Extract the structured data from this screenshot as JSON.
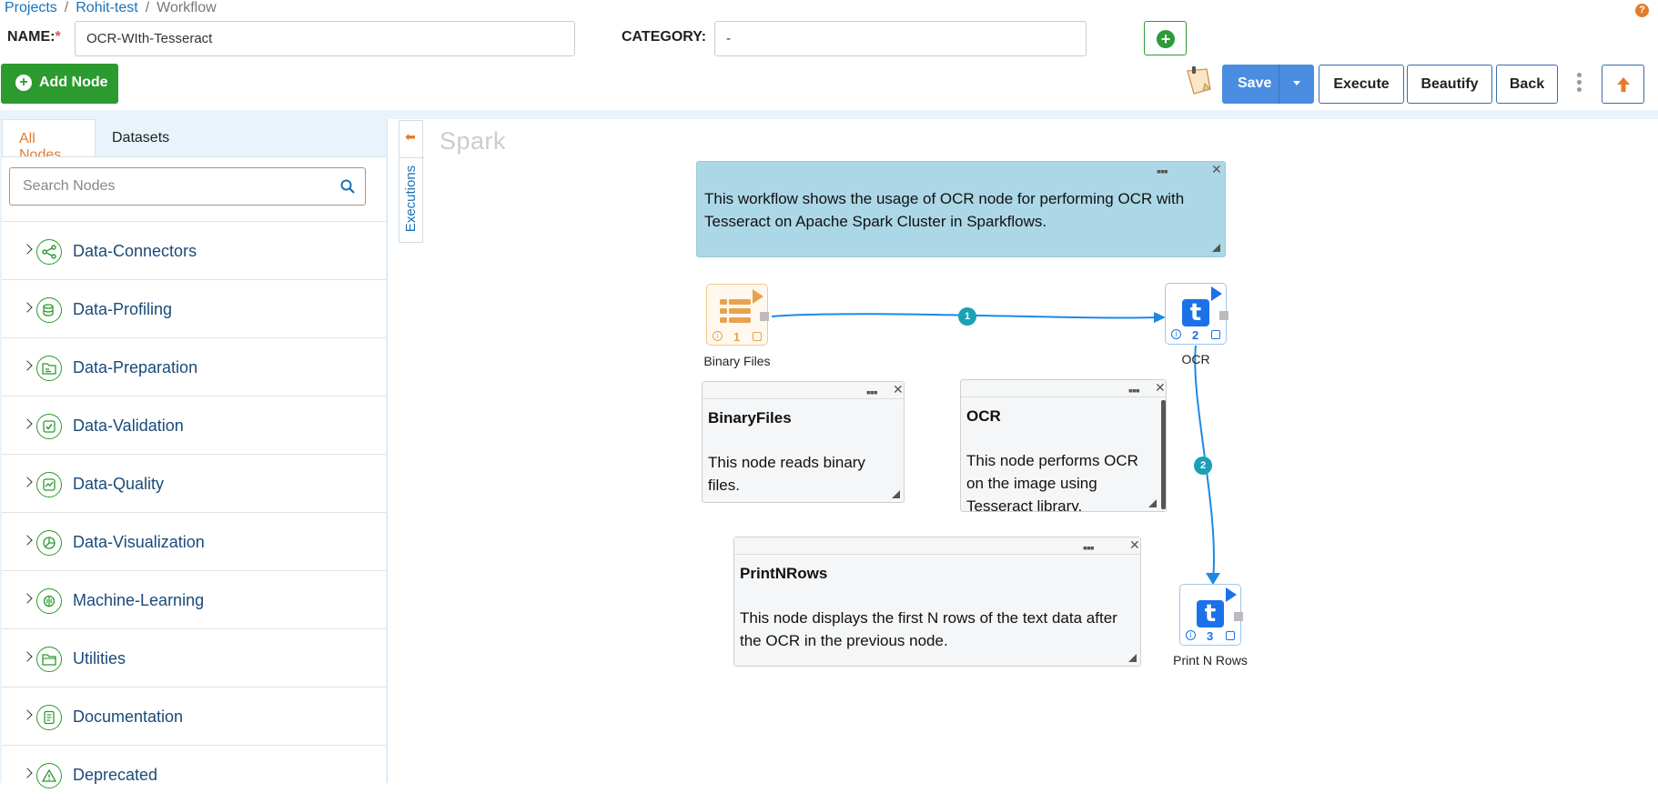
{
  "breadcrumb": {
    "items": [
      "Projects",
      "Rohit-test",
      "Workflow"
    ],
    "separator": "/"
  },
  "form": {
    "name_label": "NAME:",
    "name_required": "*",
    "name_value": "OCR-WIth-Tesseract",
    "category_label": "CATEGORY:",
    "category_value": "-"
  },
  "toolbar": {
    "add_node_label": "Add Node",
    "save_label": "Save",
    "execute_label": "Execute",
    "beautify_label": "Beautify",
    "back_label": "Back"
  },
  "sidebar": {
    "tabs": [
      {
        "label": "All Nodes",
        "active": true
      },
      {
        "label": "Datasets",
        "active": false
      }
    ],
    "search_placeholder": "Search Nodes",
    "categories": [
      {
        "label": "Data-Connectors",
        "icon": "share-icon"
      },
      {
        "label": "Data-Profiling",
        "icon": "database-icon"
      },
      {
        "label": "Data-Preparation",
        "icon": "folder-icon"
      },
      {
        "label": "Data-Validation",
        "icon": "checkbox-icon"
      },
      {
        "label": "Data-Quality",
        "icon": "chart-box-icon"
      },
      {
        "label": "Data-Visualization",
        "icon": "pie-chart-icon"
      },
      {
        "label": "Machine-Learning",
        "icon": "brain-icon"
      },
      {
        "label": "Utilities",
        "icon": "folder-icon"
      },
      {
        "label": "Documentation",
        "icon": "document-icon"
      },
      {
        "label": "Deprecated",
        "icon": "warning-icon"
      }
    ]
  },
  "canvas": {
    "executions_label": "Executions",
    "engine_label": "Spark",
    "description_note": "This workflow shows the usage of OCR node for performing OCR with Tesseract on Apache Spark Cluster in Sparkflows.",
    "nodes": [
      {
        "id": "1",
        "label": "Binary Files"
      },
      {
        "id": "2",
        "label": "OCR"
      },
      {
        "id": "3",
        "label": "Print N Rows"
      }
    ],
    "edges": [
      {
        "label": "1",
        "from": "1",
        "to": "2"
      },
      {
        "label": "2",
        "from": "2",
        "to": "3"
      }
    ],
    "notes": [
      {
        "title": "BinaryFiles",
        "body": "This node reads binary files."
      },
      {
        "title": "OCR",
        "body": "This node performs OCR on the image using Tesseract library."
      },
      {
        "title": "PrintNRows",
        "body": "This node displays the first N rows of the text data after the OCR in the previous node."
      }
    ]
  },
  "colors": {
    "primary_green": "#2b9a2f",
    "save_blue": "#4a8de0",
    "accent_orange": "#e57b2e",
    "link_blue": "#1b72b5",
    "note_blue": "#acd7e6",
    "edge_blue": "#1e88e5",
    "edge_badge": "#1aa1b6"
  }
}
